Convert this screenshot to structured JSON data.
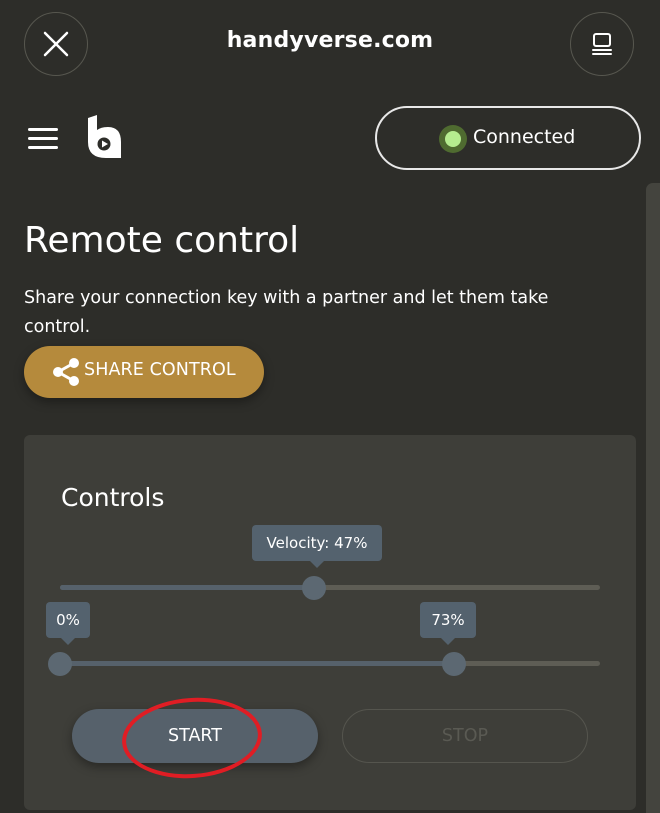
{
  "browser": {
    "url": "handyverse.com",
    "close_icon": "close-icon",
    "tabs_icon": "tabs-icon"
  },
  "header": {
    "menu_icon": "hamburger-menu-icon",
    "logo": "handyverse-logo",
    "status": {
      "label": "Connected",
      "dot_color": "#b5ec8f"
    }
  },
  "main": {
    "title": "Remote control",
    "description": "Share your connection key with a partner and let them take control.",
    "share_button": {
      "label": "SHARE CONTROL",
      "icon": "share-icon",
      "color": "#b58a3c"
    }
  },
  "controls": {
    "title": "Controls",
    "velocity": {
      "label": "Velocity: 47%",
      "value": 47
    },
    "range": {
      "min_label": "0%",
      "max_label": "73%",
      "min_value": 0,
      "max_value": 73
    },
    "start_label": "START",
    "stop_label": "STOP"
  },
  "annotation": {
    "color": "#e01d24"
  }
}
